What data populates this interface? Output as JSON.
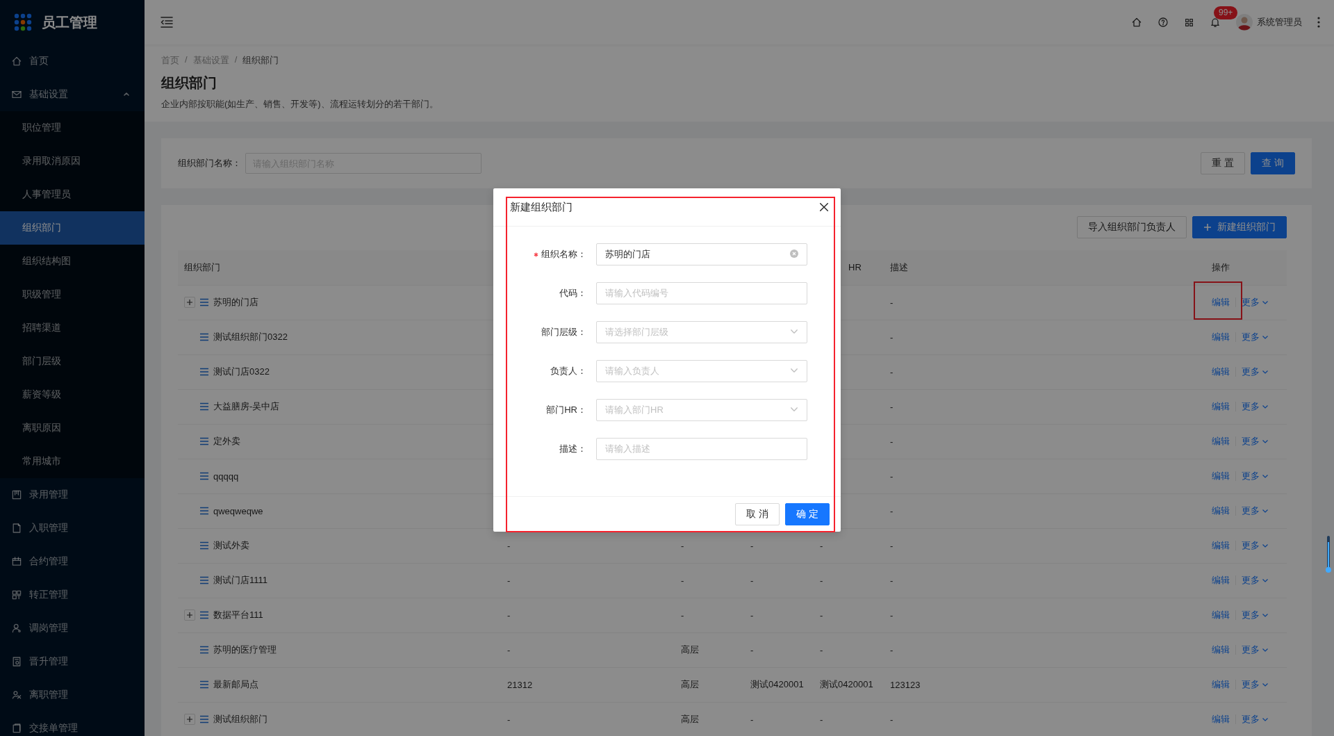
{
  "sidebar": {
    "logo_text": "员工管理",
    "items": [
      {
        "label": "首页",
        "selected": false
      },
      {
        "label": "基础设置",
        "selected": false,
        "expanded": true,
        "children": [
          {
            "label": "职位管理",
            "selected": false
          },
          {
            "label": "录用取消原因",
            "selected": false
          },
          {
            "label": "人事管理员",
            "selected": false
          },
          {
            "label": "组织部门",
            "selected": true
          },
          {
            "label": "组织结构图",
            "selected": false
          },
          {
            "label": "职级管理",
            "selected": false
          },
          {
            "label": "招聘渠道",
            "selected": false
          },
          {
            "label": "部门层级",
            "selected": false
          },
          {
            "label": "薪资等级",
            "selected": false
          },
          {
            "label": "离职原因",
            "selected": false
          },
          {
            "label": "常用城市",
            "selected": false
          }
        ]
      },
      {
        "label": "录用管理",
        "selected": false
      },
      {
        "label": "入职管理",
        "selected": false
      },
      {
        "label": "合约管理",
        "selected": false
      },
      {
        "label": "转正管理",
        "selected": false
      },
      {
        "label": "调岗管理",
        "selected": false
      },
      {
        "label": "晋升管理",
        "selected": false
      },
      {
        "label": "离职管理",
        "selected": false
      },
      {
        "label": "交接单管理",
        "selected": false
      }
    ]
  },
  "header": {
    "badge": "99+",
    "user": "系统管理员"
  },
  "breadcrumb": [
    {
      "label": "首页",
      "kind": "link"
    },
    {
      "label": "/",
      "kind": "separator"
    },
    {
      "label": "基础设置",
      "kind": "link"
    },
    {
      "label": "/",
      "kind": "separator"
    },
    {
      "label": "组织部门",
      "kind": "current"
    }
  ],
  "page": {
    "title": "组织部门",
    "description": "企业内部按职能(如生产、销售、开发等)、流程运转划分的若干部门。"
  },
  "filter": {
    "label": "组织部门名称：",
    "placeholder": "请输入组织部门名称",
    "buttons": [
      {
        "label": "重 置",
        "kind": "default"
      },
      {
        "label": "查 询",
        "kind": "primary"
      }
    ]
  },
  "toolbar": [
    {
      "label": "导入组织部门负责人",
      "kind": "default"
    },
    {
      "label": "新建组织部门",
      "kind": "primary"
    }
  ],
  "table": {
    "header": {
      "column_1": "组织部门",
      "column_5": "HR",
      "description": "描述",
      "actions": "操作"
    },
    "rows": [
      {
        "name": "苏明的门店",
        "expandable": true,
        "description": "-",
        "edit": "编辑",
        "more": "更多",
        "highlighted": true
      },
      {
        "name": "测试组织部门0322",
        "expandable": false,
        "description": "-",
        "edit": "编辑",
        "more": "更多",
        "highlighted": false
      },
      {
        "name": "测试门店0322",
        "expandable": false,
        "description": "-",
        "edit": "编辑",
        "more": "更多",
        "highlighted": false
      },
      {
        "name": "大益膳房-吴中店",
        "expandable": false,
        "description": "-",
        "edit": "编辑",
        "more": "更多",
        "highlighted": false
      },
      {
        "name": "定外卖",
        "expandable": false,
        "description": "-",
        "edit": "编辑",
        "more": "更多",
        "highlighted": false
      },
      {
        "name": "qqqqq",
        "expandable": false,
        "description": "-",
        "edit": "编辑",
        "more": "更多",
        "highlighted": false
      },
      {
        "name": "qweqweqwe",
        "expandable": false,
        "description": "-",
        "edit": "编辑",
        "more": "更多",
        "highlighted": false
      },
      {
        "name": "测试外卖",
        "expandable": false,
        "column_2": "-",
        "column_3": "-",
        "column_4": "-",
        "column_5": "-",
        "description": "-",
        "edit": "编辑",
        "more": "更多",
        "highlighted": false
      },
      {
        "name": "测试门店1111",
        "expandable": false,
        "column_2": "-",
        "column_3": "-",
        "column_4": "-",
        "column_5": "-",
        "description": "-",
        "edit": "编辑",
        "more": "更多",
        "highlighted": false
      },
      {
        "name": "数据平台111",
        "expandable": true,
        "column_2": "-",
        "column_3": "-",
        "column_4": "-",
        "column_5": "-",
        "description": "-",
        "edit": "编辑",
        "more": "更多",
        "highlighted": false
      },
      {
        "name": "苏明的医疗管理",
        "expandable": false,
        "column_2": "-",
        "column_3": "高层",
        "column_4": "-",
        "column_5": "-",
        "description": "-",
        "edit": "编辑",
        "more": "更多",
        "highlighted": false
      },
      {
        "name": "最新邮局点",
        "expandable": false,
        "column_2": "21312",
        "column_3": "高层",
        "column_4": "测试0420001",
        "column_5": "测试0420001",
        "description": "123123",
        "edit": "编辑",
        "more": "更多",
        "highlighted": false
      },
      {
        "name": "测试组织部门",
        "expandable": true,
        "column_2": "-",
        "column_3": "高层",
        "column_4": "-",
        "column_5": "-",
        "description": "-",
        "edit": "编辑",
        "more": "更多",
        "highlighted": false
      }
    ]
  },
  "dialog": {
    "title": "新建组织部门",
    "highlighted": true,
    "fields": [
      {
        "label": "组织名称：",
        "required": true,
        "kind": "input",
        "value": "苏明的门店"
      },
      {
        "label": "代码：",
        "required": false,
        "kind": "input",
        "placeholder": "请输入代码编号"
      },
      {
        "label": "部门层级：",
        "required": false,
        "kind": "select",
        "placeholder": "请选择部门层级"
      },
      {
        "label": "负责人：",
        "required": false,
        "kind": "select",
        "placeholder": "请输入负责人"
      },
      {
        "label": "部门HR：",
        "required": false,
        "kind": "select",
        "placeholder": "请输入部门HR"
      },
      {
        "label": "描述：",
        "required": false,
        "kind": "input",
        "placeholder": "请输入描述"
      }
    ],
    "buttons": [
      {
        "label": "取 消",
        "kind": "default"
      },
      {
        "label": "确 定",
        "kind": "primary"
      }
    ]
  }
}
